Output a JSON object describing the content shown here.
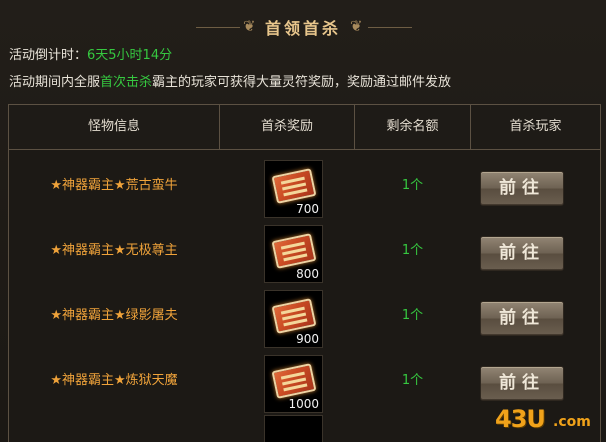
{
  "header": {
    "title": "首领首杀",
    "left_glyph": "❦",
    "right_glyph": "❦"
  },
  "countdown": {
    "label": "活动倒计时：",
    "value": "6天5小时14分"
  },
  "description": {
    "prefix": "活动期间内全服",
    "highlight": "首次击杀",
    "suffix": "霸主的玩家可获得大量灵符奖励，奖励通过邮件发放"
  },
  "table": {
    "headers": [
      "怪物信息",
      "首杀奖励",
      "剩余名额",
      "首杀玩家"
    ],
    "rows": [
      {
        "monster": "★神器霸主★荒古蛮牛",
        "reward_count": "700",
        "remaining": "1个",
        "action": "前往"
      },
      {
        "monster": "★神器霸主★无极尊主",
        "reward_count": "800",
        "remaining": "1个",
        "action": "前往"
      },
      {
        "monster": "★神器霸主★绿影屠夫",
        "reward_count": "900",
        "remaining": "1个",
        "action": "前往"
      },
      {
        "monster": "★神器霸主★炼狱天魔",
        "reward_count": "1000",
        "remaining": "1个",
        "action": "前往"
      }
    ]
  },
  "watermark": {
    "main": "43U",
    "suffix": ".com"
  },
  "colors": {
    "accent_gold": "#e8c68c",
    "monster_orange": "#f0a33a",
    "value_green": "#36c840"
  },
  "icons": {
    "reward": "spirit-talisman-scroll-icon"
  }
}
